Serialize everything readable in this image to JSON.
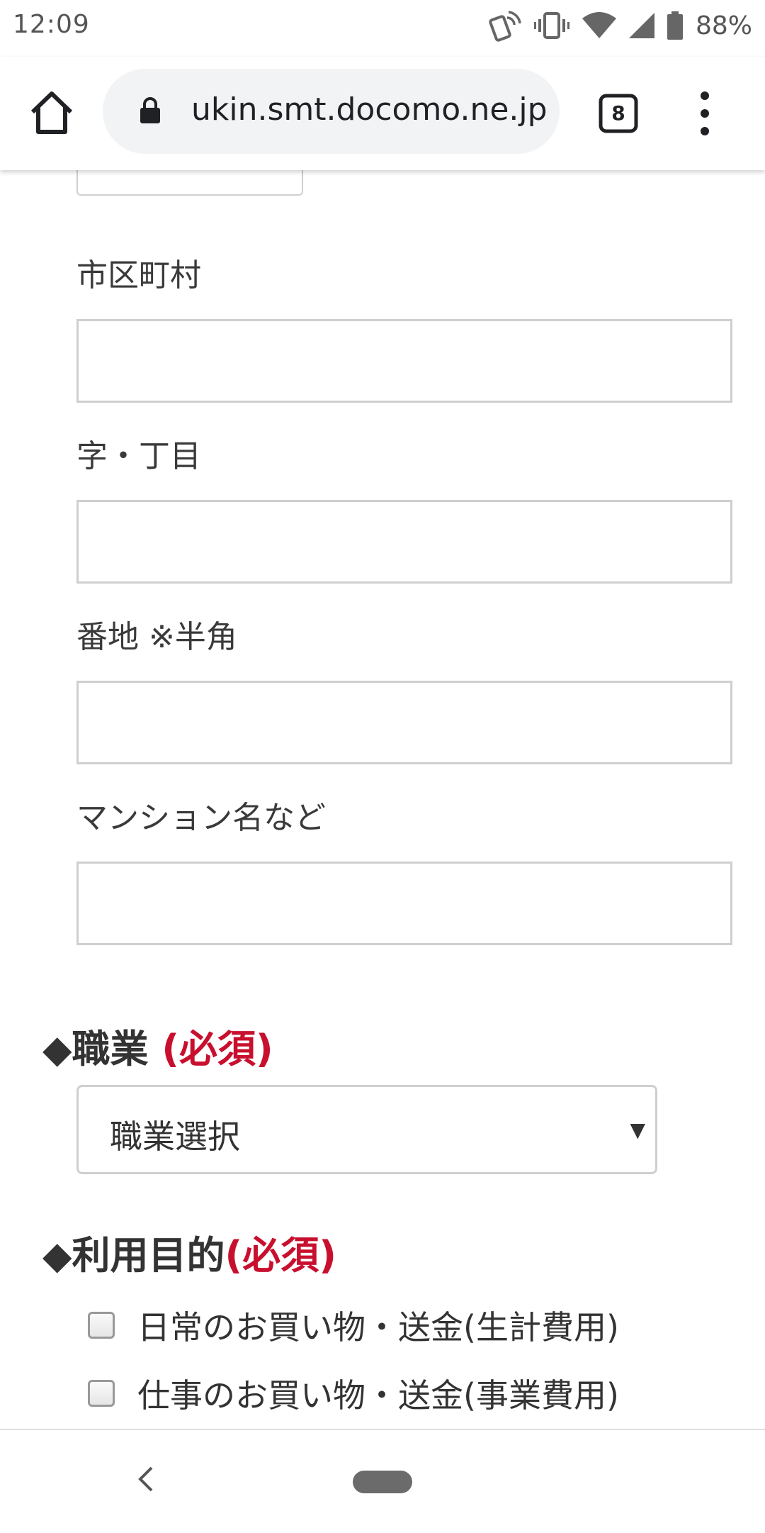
{
  "status_bar": {
    "time": "12:09",
    "battery_percent": "88%",
    "icons": [
      "nfc-phone-icon",
      "vibrate-icon",
      "wifi-icon",
      "cell-signal-icon",
      "battery-icon"
    ]
  },
  "browser": {
    "url": "ukin.smt.docomo.ne.jp",
    "tab_count": "8",
    "icons": [
      "home-icon",
      "lock-icon",
      "tabs-icon",
      "overflow-menu-icon"
    ]
  },
  "form": {
    "city_label": "市区町村",
    "city_value": "",
    "chome_label": "字・丁目",
    "chome_value": "",
    "banchi_label": "番地 ※半角",
    "banchi_value": "",
    "building_label": "マンション名など",
    "building_value": "",
    "occupation": {
      "title": "◆職業",
      "required": "(必須)",
      "selected": "職業選択"
    },
    "purpose": {
      "title": "◆利用目的",
      "required": "(必須)",
      "options": [
        {
          "label": "日常のお買い物・送金(生計費用)",
          "checked": false
        },
        {
          "label": "仕事のお買い物・送金(事業費用)",
          "checked": false
        }
      ]
    }
  },
  "colors": {
    "required": "#c8102e",
    "input_border": "#cfcfcf",
    "url_bar": "#f1f3f4"
  }
}
